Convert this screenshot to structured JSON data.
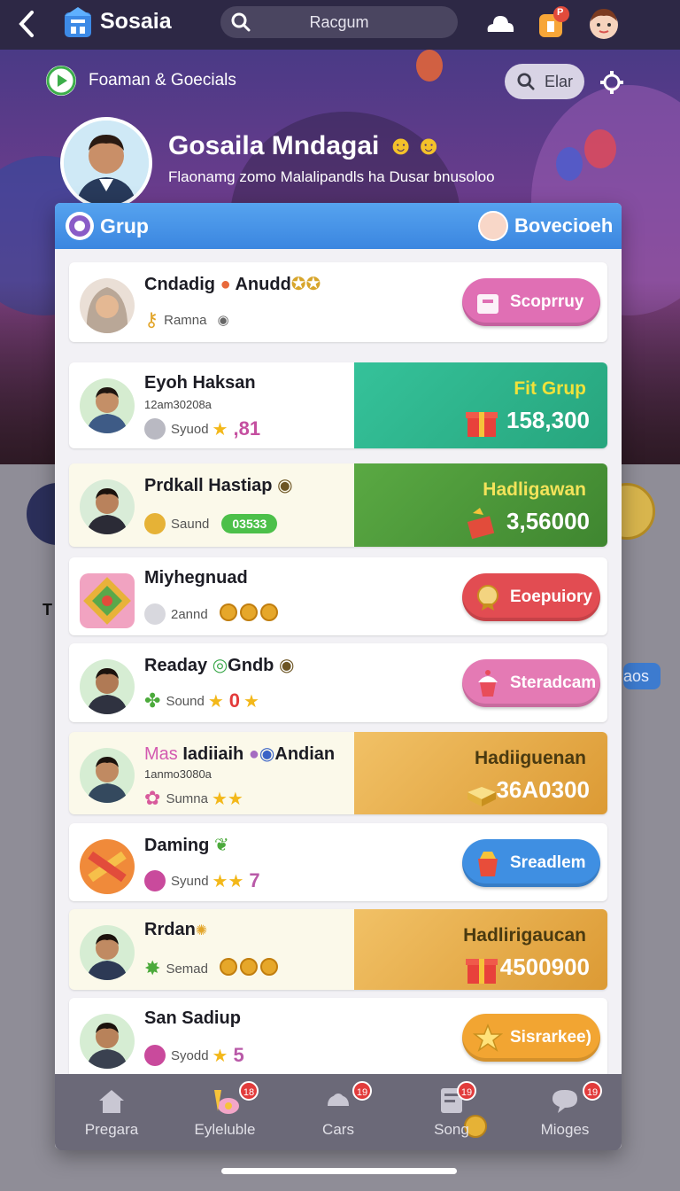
{
  "topbar": {
    "app_name": "Sosaia",
    "search_text": "Racgum",
    "notification_badge": "P"
  },
  "hero": {
    "pill_text": "Foaman & Goecials",
    "search_button": "Elar",
    "profile_name": "Gosaila Mndagai",
    "profile_subtitle": "Flaonamg zomo Malalipandls ha Dusar bnusoloo"
  },
  "side": {
    "blue_tag": "aos",
    "left_letter": "T"
  },
  "modal": {
    "title": "Grup",
    "user_label": "Bovecioeh",
    "rows": [
      {
        "name": "Cndadig",
        "name2": "Anudd",
        "meta_label": "Ramna",
        "cta": "Scoprruy",
        "cta_color": "#e06fb4"
      },
      {
        "name": "Eyoh Haksan",
        "sub": "12am30208a",
        "meta_label": "Syuod",
        "value": ",81",
        "prize_title": "Fit Grup",
        "prize_value": "158,300",
        "prize_color": "#2fb58c"
      },
      {
        "name": "Prdkall Hastiap",
        "meta_label": "Saund",
        "pill": "03533",
        "prize_title": "Hadligawan",
        "prize_value": "3,56000",
        "prize_color": "#4f9a3b"
      },
      {
        "name": "Miyhegnuad",
        "meta_label": "2annd",
        "cta": "Eoepuiory",
        "cta_color": "#e24c52"
      },
      {
        "name": "Readay",
        "name2": "Gndb",
        "meta_label": "Sound",
        "value": "0",
        "cta": "Steradcam",
        "cta_color": "#e47ab4"
      },
      {
        "name_pre": "Mas",
        "name": "Iadiiaih",
        "name2": "Andian",
        "sub": "1anmo3080a",
        "meta_label": "Sumna",
        "prize_title": "Hadiiguenan",
        "prize_value": "36A0300",
        "prize_color": "#e2a845"
      },
      {
        "name": "Daming",
        "meta_label": "Syund",
        "value": "7",
        "cta": "Sreadlem",
        "cta_color": "#3f8fe2"
      },
      {
        "name": "Rrdan",
        "meta_label": "Semad",
        "prize_title": "Hadlirigaucan",
        "prize_value": "4500900",
        "prize_color": "#e2a845"
      },
      {
        "name": "San Sadiup",
        "meta_label": "Syodd",
        "value": "5",
        "cta": "Sisrarkee)",
        "cta_color": "#f2a532"
      }
    ]
  },
  "tabs": [
    {
      "label": "Pregara",
      "badge": ""
    },
    {
      "label": "Eyleluble",
      "badge": "18"
    },
    {
      "label": "Cars",
      "badge": "19"
    },
    {
      "label": "Song",
      "badge": "19"
    },
    {
      "label": "Mioges",
      "badge": "19"
    }
  ]
}
